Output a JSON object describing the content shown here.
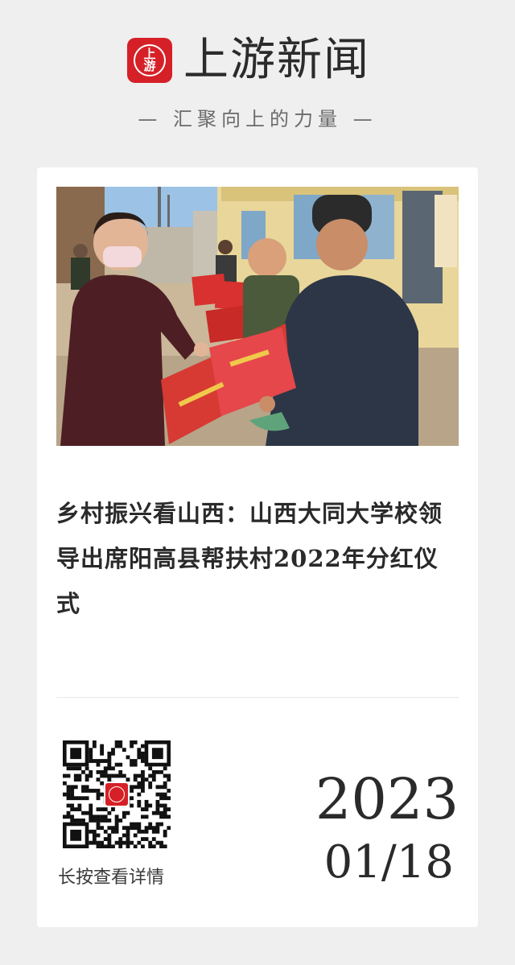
{
  "header": {
    "brand_logo_text": "上游",
    "brand_name": "上游新闻",
    "slogan": "— 汇聚向上的力量 —",
    "brand_color": "#d62027"
  },
  "article": {
    "photo_description_icon": "news-photo",
    "title": "乡村振兴看山西：山西大同大学校领导出席阳高县帮扶村2022年分红仪式"
  },
  "footer": {
    "qr_icon": "qr-code-icon",
    "press_hint": "长按查看详情",
    "date_year": "2023",
    "date_month_day": "01/18"
  }
}
